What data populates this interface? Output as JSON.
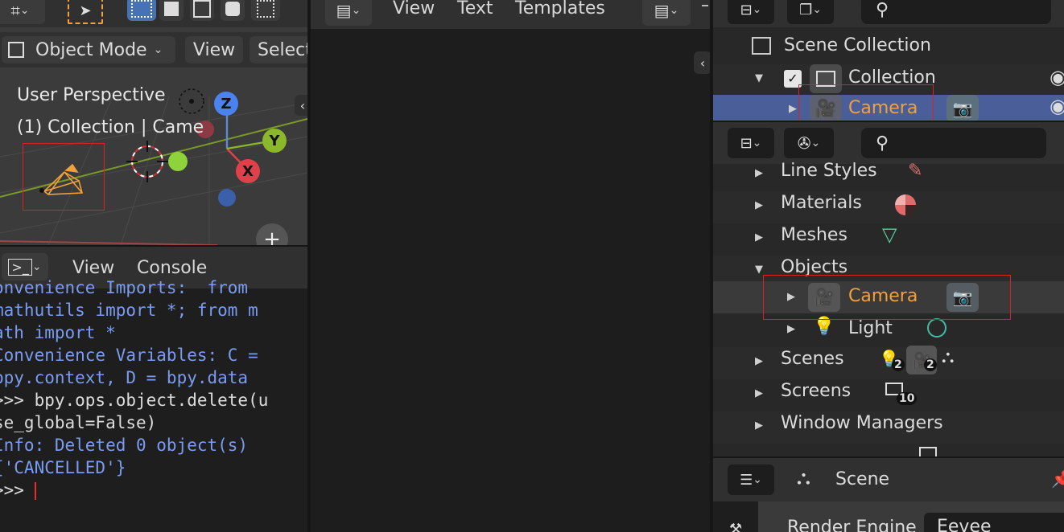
{
  "viewport": {
    "mode_label": "Object Mode",
    "menu_view": "View",
    "menu_select": "Select",
    "overlay_line1": "User Perspective",
    "overlay_line2": "(1) Collection | Came",
    "axis_z": "Z",
    "axis_y": "Y",
    "axis_x": "X"
  },
  "text_editor": {
    "menu_view": "View",
    "menu_text": "Text",
    "menu_templates": "Templates"
  },
  "console": {
    "menu_view": "View",
    "menu_console": "Console",
    "lines": [
      "onvenience Imports:  from",
      "mathutils import *; from m",
      "ath import *",
      "Convenience Variables: C =",
      "bpy.context, D = bpy.data",
      "",
      ">>> bpy.ops.object.delete(u",
      "se_global=False)",
      "Info: Deleted 0 object(s)",
      "{'CANCELLED'}",
      "",
      ">>> "
    ]
  },
  "outliner_top": {
    "scene_collection": "Scene Collection",
    "collection": "Collection",
    "camera": "Camera"
  },
  "outliner_blend": {
    "rows": {
      "line_styles": "Line Styles",
      "materials": "Materials",
      "meshes": "Meshes",
      "objects": "Objects",
      "camera": "Camera",
      "light": "Light",
      "scenes": "Scenes",
      "screens": "Screens",
      "window_managers": "Window Managers"
    },
    "scenes_badge_light": "2",
    "scenes_badge_camera": "2",
    "screens_badge": "10"
  },
  "properties": {
    "tab_label": "Scene",
    "render_engine_label": "Render Engine",
    "render_engine_value": "Eevee"
  },
  "colors": {
    "selection": "#5a7bd0",
    "orange": "#f1a03c",
    "camera_data": "#49b8a0",
    "red_highlight": "#e02020"
  }
}
